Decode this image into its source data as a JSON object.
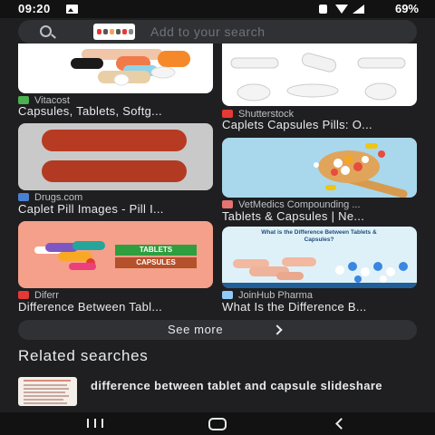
{
  "status_bar": {
    "time": "09:20",
    "battery": "69%"
  },
  "search": {
    "placeholder": "Add to your search"
  },
  "results": [
    {
      "source": "Vitacost",
      "caption": "Capsules, Tablets, Softg...",
      "icon": "vitacost-favicon",
      "color": "#4caf50"
    },
    {
      "source": "Shutterstock",
      "caption": "Caplets Capsules Pills: O...",
      "icon": "shutterstock-favicon",
      "color": "#e53935"
    },
    {
      "source": "Drugs.com",
      "caption": "Caplet Pill Images - Pill I...",
      "icon": "drugs-com-favicon",
      "color": "#4a7fd1"
    },
    {
      "source": "VetMedics Compounding ...",
      "caption": "Tablets & Capsules | Ne...",
      "icon": "vetmedics-favicon",
      "color": "#e57373"
    },
    {
      "source": "Diferr",
      "caption": "Difference Between Tabl...",
      "icon": "diferr-favicon",
      "color": "#e53935"
    },
    {
      "source": "JoinHub Pharma",
      "caption": "What Is the Difference B...",
      "icon": "joinhub-favicon",
      "color": "#90caf9"
    }
  ],
  "image_text": {
    "tablets_label": "TABLETS",
    "capsules_label": "CAPSULES",
    "joinhub_title": "What is the Difference Between Tablets & Capsules?"
  },
  "see_more": {
    "label": "See more"
  },
  "related": {
    "heading": "Related searches",
    "items": [
      {
        "text": "difference between tablet and capsule slideshare"
      }
    ]
  }
}
